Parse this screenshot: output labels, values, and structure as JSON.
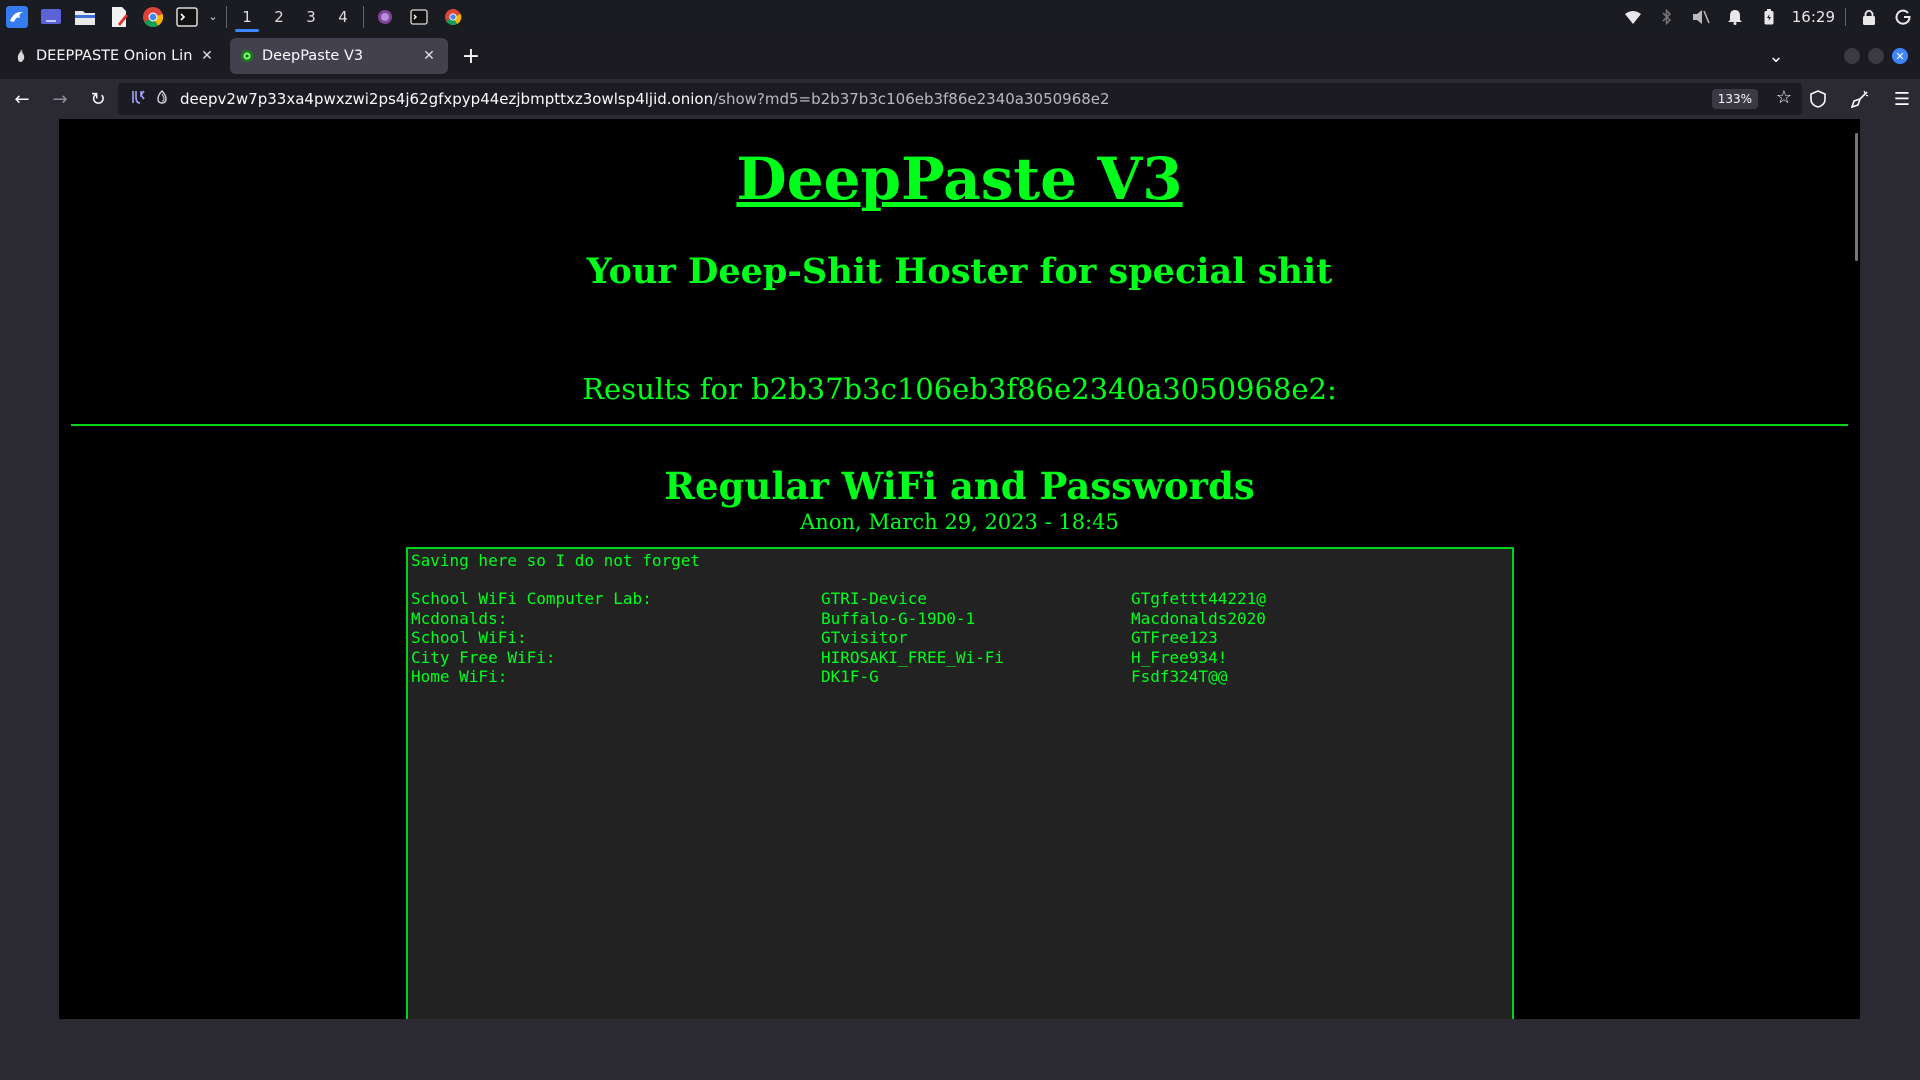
{
  "taskbar": {
    "workspaces": [
      "1",
      "2",
      "3",
      "4"
    ],
    "active_workspace": "1",
    "clock": "16:29"
  },
  "tabs": [
    {
      "title": "DEEPPASTE Onion Links",
      "active": false
    },
    {
      "title": "DeepPaste V3",
      "active": true
    }
  ],
  "nav": {
    "url_host": "deepv2w7p33xa4pwxzwi2ps4j62gfxpyp44ezjbmpttxz3owlsp4ljid.onion",
    "url_path": "/show?md5=b2b37b3c106eb3f86e2340a3050968e2",
    "zoom": "133%"
  },
  "page": {
    "title": "DeepPaste V3",
    "subtitle": "Your Deep-Shit Hoster for special shit",
    "results_heading": "Results for b2b37b3c106eb3f86e2340a3050968e2:",
    "paste": {
      "title": "Regular WiFi and Passwords",
      "meta": "Anon, March 29, 2023 - 18:45",
      "intro": "Saving here so I do not forget",
      "rows": [
        [
          "School WiFi Computer Lab:",
          "GTRI-Device",
          "GTgfettt44221@"
        ],
        [
          "Mcdonalds:",
          "Buffalo-G-19D0-1",
          "Macdonalds2020"
        ],
        [
          "School WiFi:",
          "GTvisitor",
          "GTFree123"
        ],
        [
          "City Free WiFi:",
          "HIROSAKI_FREE_Wi-Fi",
          "H_Free934!"
        ],
        [
          "Home WiFi:",
          "DK1F-G",
          "Fsdf324T@@"
        ]
      ]
    }
  },
  "colors": {
    "page_bg": "#000000",
    "text_green": "#00ff1a",
    "paste_bg": "#222222",
    "browser_bg": "#2b2a33"
  }
}
